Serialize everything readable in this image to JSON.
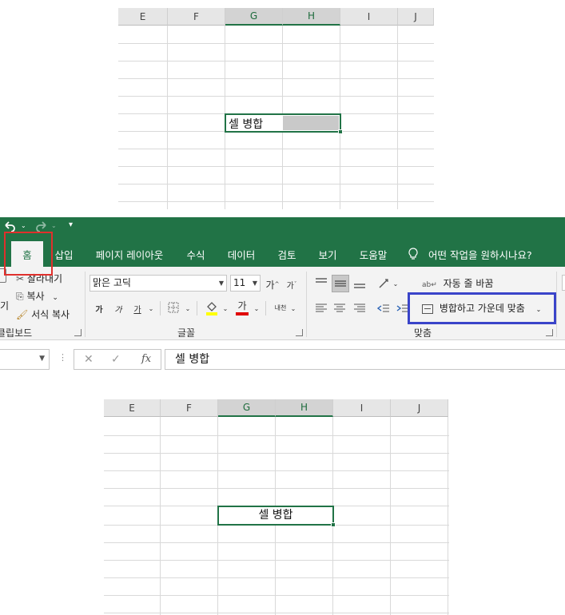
{
  "top_sheet": {
    "columns": [
      "E",
      "F",
      "G",
      "H",
      "I",
      "J"
    ],
    "selected_columns": [
      "G",
      "H"
    ],
    "cell_text": "셀 병합"
  },
  "quick_access": {
    "undo_icon": "undo-icon",
    "redo_icon": "redo-icon",
    "customize": "▾"
  },
  "tabs": [
    {
      "label": "홈",
      "active": true
    },
    {
      "label": "삽입"
    },
    {
      "label": "페이지 레이아웃"
    },
    {
      "label": "수식"
    },
    {
      "label": "데이터"
    },
    {
      "label": "검토"
    },
    {
      "label": "보기"
    },
    {
      "label": "도움말"
    }
  ],
  "tell_me": "어떤 작업을 원하시나요?",
  "clipboard": {
    "cut": "잘라내기",
    "copy": "복사",
    "format_painter": "서식 복사",
    "paste_partial": "기",
    "label": "클립보드"
  },
  "font": {
    "name": "맑은 고딕",
    "size": "11",
    "grow": "가",
    "shrink": "가",
    "bold": "가",
    "italic": "가",
    "underline": "가",
    "font_color": "가",
    "phonetic": "내천",
    "label": "글꼴"
  },
  "alignment": {
    "wrap_text": "자동 줄 바꿈",
    "merge_center": "병합하고 가운데 맞춤",
    "label": "맞춤"
  },
  "formula_bar": {
    "cancel": "✕",
    "enter": "✓",
    "fx": "fx",
    "value": "셀 병합"
  },
  "bottom_sheet": {
    "columns": [
      "E",
      "F",
      "G",
      "H",
      "I",
      "J"
    ],
    "selected_columns": [
      "G",
      "H"
    ],
    "cell_text": "셀 병합"
  },
  "colors": {
    "excel_green": "#217346",
    "highlight_red": "#e0302c",
    "highlight_blue": "#3a44c9",
    "fill_yellow": "#ffff00",
    "font_red": "#e00000"
  }
}
